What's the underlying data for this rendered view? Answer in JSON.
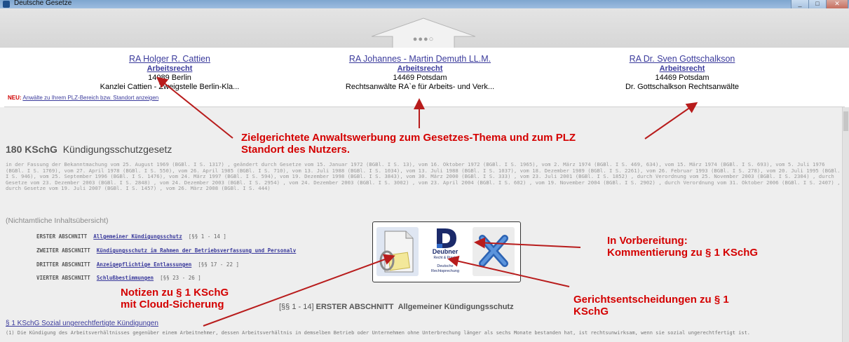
{
  "window": {
    "title": "Deutsche Gesetze",
    "minimize": "_",
    "maximize": "□",
    "close": "✕"
  },
  "pager": {
    "dots": "●●●○"
  },
  "ads": [
    {
      "name": "RA Holger R. Cattien",
      "category": "Arbeitsrecht",
      "city": "14089 Berlin",
      "firm": "Kanzlei Cattien - Zweigstelle Berlin-Kla..."
    },
    {
      "name": "RA Johannes - Martin Demuth LL.M.",
      "category": "Arbeitsrecht",
      "city": "14469 Potsdam",
      "firm": "Rechtsanwälte RA`e für Arbeits- und Verk..."
    },
    {
      "name": "RA Dr. Sven Gottschalkson",
      "category": "Arbeitsrecht",
      "city": "14469 Potsdam",
      "firm": "Dr. Gottschalkson Rechtsanwälte"
    }
  ],
  "neu": {
    "badge": "NEU:",
    "link": "Anwälte zu Ihrem PLZ-Bereich bzw. Standort anzeigen"
  },
  "law": {
    "number": "180 KSchG",
    "name": "Kündigungsschutzgesetz",
    "history": "in der Fassung der Bekanntmachung vom 25. August 1969 (BGBl. I S. 1317) , geändert durch Gesetze vom 15. Januar 1972 (BGBl. I S. 13), vom 16. Oktober 1972 (BGBl. I S. 1965), vom 2. März 1974 (BGBl. I S. 469, 634), vom 15. März 1974 (BGBl. I S. 693), vom 5. Juli 1976 (BGBl. I S. 1769), vom 27. April 1978 (BGBl. I S. 550), vom 26. April 1985 (BGBl. I S. 710), vom 13. Juli 1988 (BGBl. I S. 1034), vom 13. Juli 1988 (BGBl. I S. 1037), vom 18. Dezember 1989 (BGBl. I S. 2261), vom 26. Februar 1993 (BGBl. I S. 278), vom 20. Juli 1995 (BGBl. I S. 946), vom 25. September 1996 (BGBl. I S. 1476), vom 24. März 1997 (BGBl. I S. 594), vom 19. Dezember 1998 (BGBl. I S. 3843), vom 30. März 2000 (BGBl. I S. 333) , vom 23. Juli 2001 (BGBl. I S. 1852) , durch Verordnung vom 25. November 2003 (BGBl. I S. 2304) , durch Gesetze vom 23. Dezember 2003 (BGBl. I S. 2848) , vom 24. Dezember 2003 (BGBl. I S. 2954) , vom 24. Dezember 2003 (BGBl. I S. 3002) , vom 23. April 2004 (BGBl. I S. 602) , vom 19. November 2004 (BGBl. I S. 2902) , durch Verordnung vom 31. Oktober 2006 (BGBl. I S. 2407) , durch Gesetze vom 19. Juli 2007 (BGBl. I S. 1457) , vom 26. März 2008 (BGBl. I S. 444)",
    "overview": "(Nichtamtliche Inhaltsübersicht)"
  },
  "toc": [
    {
      "label": "ERSTER ABSCHNITT",
      "link": "Allgemeiner Kündigungsschutz",
      "range": "[§§ 1 - 14 ]"
    },
    {
      "label": "ZWEITER ABSCHNITT",
      "link": "Kündigungsschutz im Rahmen der Betriebsverfassung und Personalv",
      "range": ""
    },
    {
      "label": "DRITTER ABSCHNITT",
      "link": "Anzeigepflichtige Entlassungen",
      "range": "[§§ 17 - 22 ]"
    },
    {
      "label": "VIERTER ABSCHNITT",
      "link": "Schlußbestimmungen",
      "range": "[§§ 23 - 26 ]"
    }
  ],
  "section": {
    "range": "[§§ 1 - 14]",
    "title": "ERSTER ABSCHNITT",
    "subtitle": "Allgemeiner Kündigungsschutz"
  },
  "section_link": "§ 1 KSchG Sozial ungerechtfertigte Kündigungen",
  "paragraph": "(1) Die Kündigung des Arbeitsverhältnisses gegenüber einem Arbeitnehmer, dessen Arbeitsverhältnis in demselben Betrieb oder Unternehmen ohne Unterbrechung länger als sechs Monate bestanden hat, ist rechtsunwirksam, wenn sie sozial ungerechtfertigt ist.",
  "popup": {
    "deubner_brand": "Deubner",
    "deubner_sub": "Recht & Praxis",
    "deubner_line1": "Deutsche",
    "deubner_line2": "Rechtsprechung"
  },
  "annotations": {
    "ads": [
      "Zielgerichtete Anwaltswerbung zum Gesetzes-Thema und zum PLZ",
      "Standort des Nutzers."
    ],
    "comment": [
      "In Vorbereitung:",
      "Kommentierung zu § 1 KSchG"
    ],
    "notes": [
      "Notizen zu § 1 KSchG",
      "mit Cloud-Sicherung"
    ],
    "court": [
      "Gerichtsentscheidungen zu § 1",
      "KSchG"
    ]
  },
  "colors": {
    "annotation": "#d40000",
    "link": "#3b3b9c",
    "arrow": "#b81c1c"
  }
}
